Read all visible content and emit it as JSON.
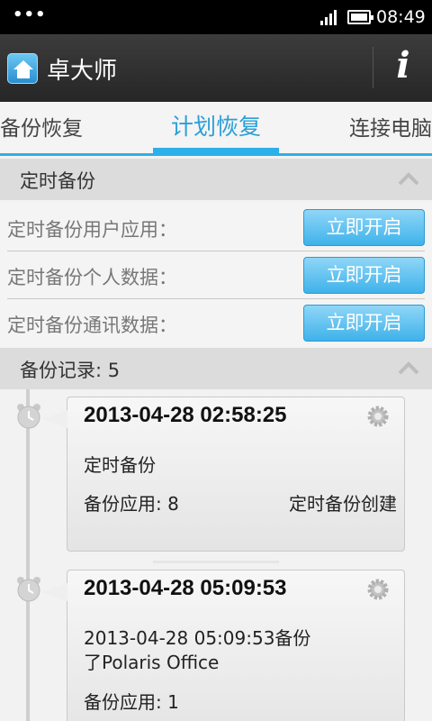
{
  "status_bar": {
    "left_dots": "•••",
    "time": "08:49",
    "icons": [
      "signal-icon",
      "battery-icon"
    ]
  },
  "title_bar": {
    "app_title": "卓大师",
    "info_label": "i",
    "icons": [
      "app-home-icon",
      "info-icon"
    ]
  },
  "tabs": [
    {
      "label": "备份恢复",
      "active": false
    },
    {
      "label": "计划恢复",
      "active": true
    },
    {
      "label": "连接电脑",
      "active": false
    }
  ],
  "scheduled_section": {
    "title": "定时备份",
    "rows": [
      {
        "label": "定时备份用户应用：",
        "button": "立即开启"
      },
      {
        "label": "定时备份个人数据：",
        "button": "立即开启"
      },
      {
        "label": "定时备份通讯数据：",
        "button": "立即开启"
      }
    ]
  },
  "records_section": {
    "title": "备份记录: 5",
    "records": [
      {
        "datetime": "2013-04-28 02:58:25",
        "description": "定时备份",
        "apps": "备份应用: 8",
        "type": "定时备份创建"
      },
      {
        "datetime": "2013-04-28 05:09:53",
        "description_line1": "2013-04-28 05:09:53备份",
        "description_line2": "了Polaris Office",
        "apps": "备份应用: 1"
      }
    ]
  },
  "colors": {
    "accent": "#2bb0e8",
    "button": "#3fb2ea",
    "title_bar": "#2e2e2e"
  }
}
